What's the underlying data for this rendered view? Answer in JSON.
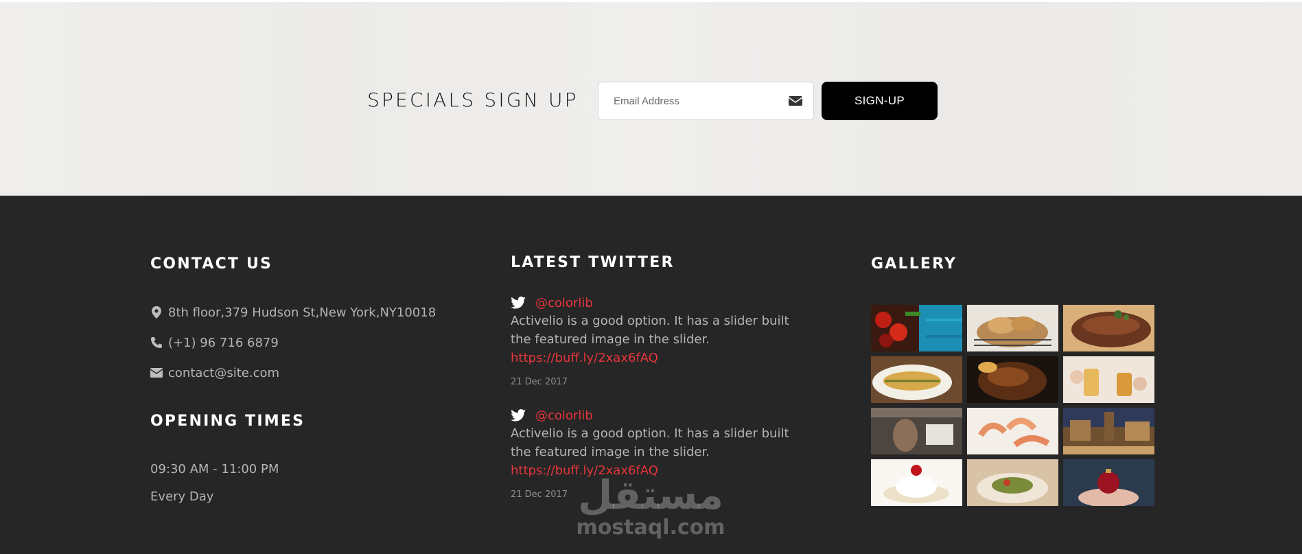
{
  "signup": {
    "title": "SPECIALS SIGN UP",
    "email_placeholder": "Email Address",
    "button_label": "SIGN-UP"
  },
  "contact": {
    "title": "CONTACT US",
    "address": "8th floor,379 Hudson St,New York,NY10018",
    "phone": "(+1) 96 716 6879",
    "email": "contact@site.com"
  },
  "opening": {
    "title": "OPENING TIMES",
    "hours": "09:30 AM - 11:00 PM",
    "days": "Every Day"
  },
  "twitter": {
    "title": "LATEST TWITTER",
    "tweets": [
      {
        "handle": "@colorlib",
        "text": "Activelio is a good option. It has a slider built the featured image in the slider.",
        "link": "https://buff.ly/2xax6fAQ",
        "date": "21 Dec 2017"
      },
      {
        "handle": "@colorlib",
        "text": "Activelio is a good option. It has a slider built the featured image in the slider.",
        "link": "https://buff.ly/2xax6fAQ",
        "date": "21 Dec 2017"
      }
    ]
  },
  "gallery": {
    "title": "GALLERY",
    "images": [
      "chili-peppers",
      "bread-basket",
      "grilled-steak",
      "grilled-fish",
      "glazed-meat",
      "cocktail-glasses",
      "restaurant-kitchen",
      "shrimp-platter",
      "old-town-square",
      "cherry-dessert",
      "salad-plate",
      "ornament-in-hands"
    ]
  },
  "watermark": {
    "arabic": "مستقل",
    "latin": "mostaql.com"
  },
  "colors": {
    "accent": "#e6353c",
    "footer_bg": "#262626",
    "signup_bg": "#eeedeb",
    "button_bg": "#000000"
  }
}
